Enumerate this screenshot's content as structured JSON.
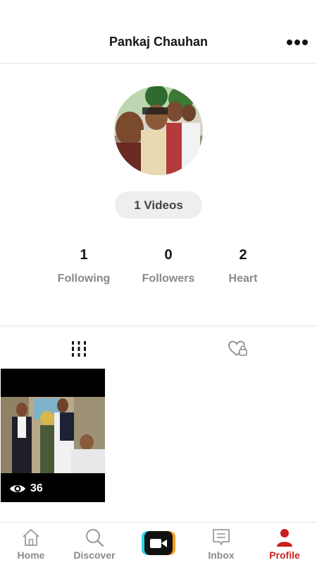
{
  "header": {
    "title": "Pankaj Chauhan"
  },
  "profile": {
    "videos_label": "1 Videos"
  },
  "stats": [
    {
      "value": "1",
      "label": "Following"
    },
    {
      "value": "0",
      "label": "Followers"
    },
    {
      "value": "2",
      "label": "Heart"
    }
  ],
  "videos": [
    {
      "views": "36"
    }
  ],
  "nav": {
    "home": "Home",
    "discover": "Discover",
    "inbox": "Inbox",
    "profile": "Profile"
  },
  "colors": {
    "accent": "#c81f1f",
    "muted": "#8a8a8a",
    "record_cyan": "#2bd6e3",
    "record_orange": "#f7a11a"
  },
  "icons": [
    "more-icon",
    "grid-icon",
    "heart-lock-icon",
    "eye-icon",
    "home-icon",
    "search-icon",
    "camera-icon",
    "inbox-icon",
    "person-icon"
  ]
}
